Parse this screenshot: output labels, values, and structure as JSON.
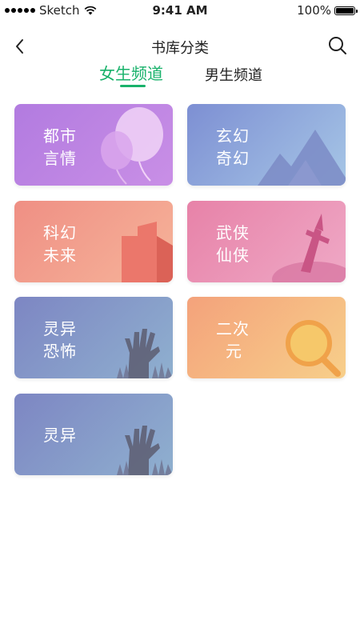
{
  "status_bar": {
    "carrier": "Sketch",
    "time": "9:41 AM",
    "battery": "100%"
  },
  "nav": {
    "title": "书库分类",
    "back_icon": "back-arrow-icon",
    "search_icon": "search-icon"
  },
  "tabs": [
    {
      "label": "女生频道",
      "active": true
    },
    {
      "label": "男生频道",
      "active": false
    }
  ],
  "accent_color": "#19b26b",
  "categories": [
    {
      "line1": "都市",
      "line2": "言情",
      "icon": "balloon-icon",
      "color": "#b27be0"
    },
    {
      "line1": "玄幻",
      "line2": "奇幻",
      "icon": "mountain-icon",
      "color": "#7d8fd3"
    },
    {
      "line1": "科幻",
      "line2": "未来",
      "icon": "building-icon",
      "color": "#ef8f84"
    },
    {
      "line1": "武侠",
      "line2": "仙侠",
      "icon": "sword-icon",
      "color": "#e782a8"
    },
    {
      "line1": "灵异",
      "line2": "恐怖",
      "icon": "zombie-hand-icon",
      "color": "#7d86c3"
    },
    {
      "line1": "二次",
      "line2": "元",
      "icon": "magnifier-icon",
      "color": "#f4a27b"
    },
    {
      "line1": "灵异",
      "line2": "",
      "icon": "zombie-hand-icon",
      "color": "#7d86c3"
    }
  ]
}
